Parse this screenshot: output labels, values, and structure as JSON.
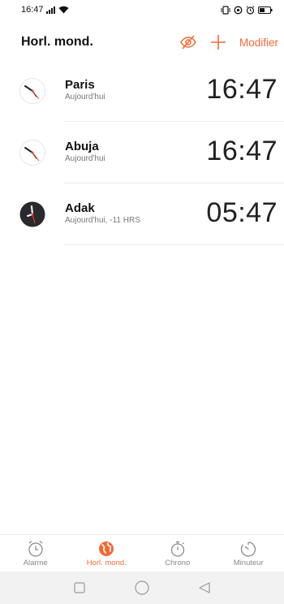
{
  "status_bar": {
    "time": "16:47"
  },
  "header": {
    "title": "Horl. mond.",
    "modify_label": "Modifier",
    "accent_color": "#f06a38"
  },
  "clocks": [
    {
      "city": "Paris",
      "subtitle": "Aujourd'hui",
      "time": "16:47",
      "face": "light"
    },
    {
      "city": "Abuja",
      "subtitle": "Aujourd'hui",
      "time": "16:47",
      "face": "light"
    },
    {
      "city": "Adak",
      "subtitle": "Aujourd'hui, -11 HRS",
      "time": "05:47",
      "face": "dark"
    }
  ],
  "tabs": [
    {
      "label": "Alarme",
      "icon": "alarm-clock-icon",
      "active": false
    },
    {
      "label": "Horl. mond.",
      "icon": "globe-icon",
      "active": true
    },
    {
      "label": "Chrono",
      "icon": "stopwatch-icon",
      "active": false
    },
    {
      "label": "Minuteur",
      "icon": "timer-icon",
      "active": false
    }
  ],
  "nav": [
    "square-recent-icon",
    "circle-home-icon",
    "triangle-back-icon"
  ]
}
